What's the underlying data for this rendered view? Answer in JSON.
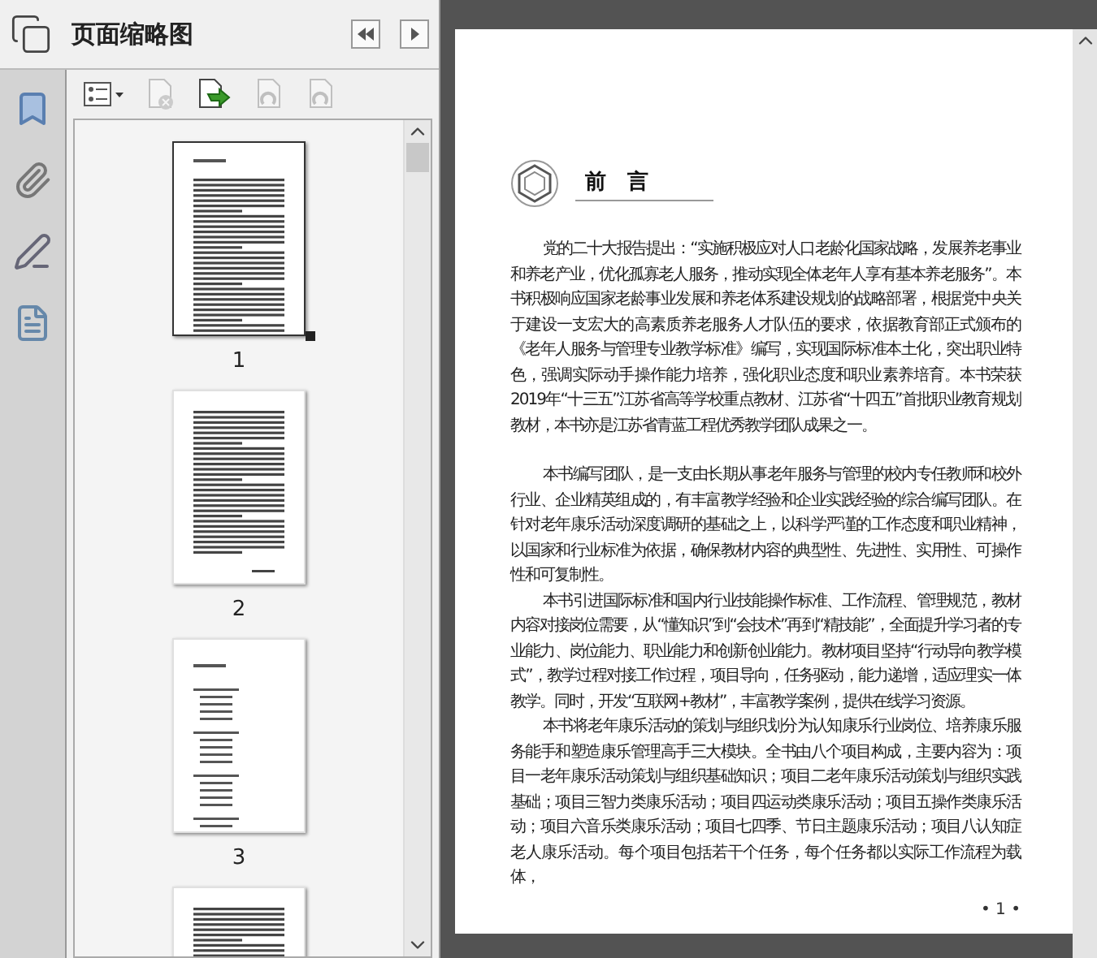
{
  "panel": {
    "title": "页面缩略图"
  },
  "toolbar": [
    {
      "kind": "options",
      "disabled": false
    },
    {
      "kind": "delete",
      "disabled": true
    },
    {
      "kind": "insert",
      "disabled": false
    },
    {
      "kind": "rotate-left",
      "disabled": true
    },
    {
      "kind": "rotate-right",
      "disabled": true
    }
  ],
  "thumbnails": [
    {
      "label": "1",
      "selected": true
    },
    {
      "label": "2",
      "selected": false
    },
    {
      "label": "3",
      "selected": false
    },
    {
      "selected": false
    }
  ],
  "page": {
    "heading": "前　言",
    "paragraphs": [
      "党的二十大报告提出：“实施积极应对人口老龄化国家战略，发展养老事业和养老产业，优化孤寡老人服务，推动实现全体老年人享有基本养老服务”。本书积极响应国家老龄事业发展和养老体系建设规划的战略部署，根据党中央关于建设一支宏大的高素质养老服务人才队伍的要求，依据教育部正式颁布的《老年人服务与管理专业教学标准》编写，实现国际标准本土化，突出职业特色，强调实际动手操作能力培养，强化职业态度和职业素养培育。本书荣获2019年“十三五”江苏省高等学校重点教材、江苏省“十四五”首批职业教育规划教材，本书亦是江苏省青蓝工程优秀教学团队成果之一。",
      "本书编写团队，是一支由长期从事老年服务与管理的校内专任教师和校外行业、企业精英组成的，有丰富教学经验和企业实践经验的综合编写团队。在针对老年康乐活动深度调研的基础之上，以科学严谨的工作态度和职业精神，以国家和行业标准为依据，确保教材内容的典型性、先进性、实用性、可操作性和可复制性。",
      "本书引进国际标准和国内行业技能操作标准、工作流程、管理规范，教材内容对接岗位需要，从“懂知识”到“会技术”再到“精技能”，全面提升学习者的专业能力、岗位能力、职业能力和创新创业能力。教材项目坚持“行动导向教学模式”，教学过程对接工作过程，项目导向，任务驱动，能力递增，适应理实一体教学。同时，开发“互联网+教材”，丰富教学案例，提供在线学习资源。",
      "本书将老年康乐活动的策划与组织划分为认知康乐行业岗位、培养康乐服务能手和塑造康乐管理高手三大模块。全书由八个项目构成，主要内容为：项目一老年康乐活动策划与组织基础知识；项目二老年康乐活动策划与组织实践基础；项目三智力类康乐活动；项目四运动类康乐活动；项目五操作类康乐活动；项目六音乐类康乐活动；项目七四季、节日主题康乐活动；项目八认知症老人康乐活动。每个项目包括若干个任务，每个任务都以实际工作流程为载体，"
    ],
    "page_number": "• 1 •"
  }
}
